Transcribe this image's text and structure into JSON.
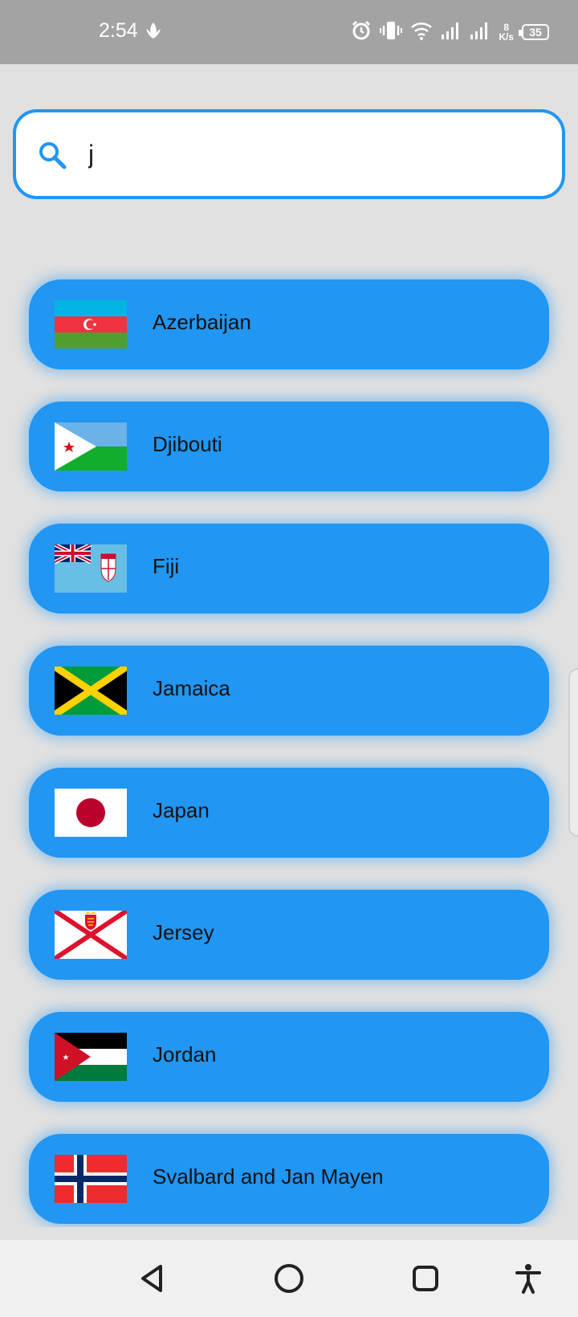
{
  "status_bar": {
    "time": "2:54",
    "net_speed_value": "8",
    "net_speed_unit": "K/s",
    "battery": "35",
    "icons": [
      "leaf-icon",
      "alarm-icon",
      "vibrate-icon",
      "wifi-icon",
      "signal-icon",
      "signal-icon",
      "battery-icon"
    ]
  },
  "search": {
    "value": "j",
    "icon": "search-icon",
    "accent_color": "#2196f3"
  },
  "countries": [
    {
      "name": "Azerbaijan",
      "flag": "azerbaijan-flag"
    },
    {
      "name": "Djibouti",
      "flag": "djibouti-flag"
    },
    {
      "name": "Fiji",
      "flag": "fiji-flag"
    },
    {
      "name": "Jamaica",
      "flag": "jamaica-flag"
    },
    {
      "name": "Japan",
      "flag": "japan-flag"
    },
    {
      "name": "Jersey",
      "flag": "jersey-flag"
    },
    {
      "name": "Jordan",
      "flag": "jordan-flag"
    },
    {
      "name": "Svalbard and Jan Mayen",
      "flag": "norway-flag"
    }
  ],
  "nav_bar": {
    "buttons": [
      "back-icon",
      "home-icon",
      "recents-icon",
      "accessibility-icon"
    ]
  },
  "colors": {
    "item_background": "#2196f3",
    "page_background": "#e1e1e1",
    "status_bar": "#a3a3a3"
  }
}
